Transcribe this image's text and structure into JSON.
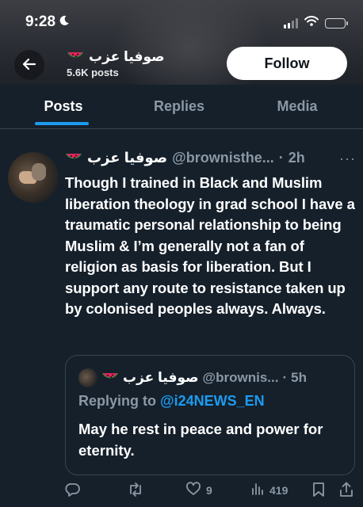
{
  "status_bar": {
    "time": "9:28"
  },
  "header": {
    "profile_name": "صوفيا عزب",
    "post_count": "5.6K posts",
    "follow_label": "Follow"
  },
  "tabs": [
    {
      "label": "Posts",
      "active": true
    },
    {
      "label": "Replies",
      "active": false
    },
    {
      "label": "Media",
      "active": false
    }
  ],
  "tweet": {
    "name": "صوفيا عزب",
    "handle": "@brownisthe...",
    "separator": "·",
    "time": "2h",
    "more": "···",
    "body": "Though I trained in Black and Muslim liberation theology in grad school I have a traumatic personal relationship to being Muslim & I’m generally not a fan of religion as basis for liberation. But I support any route to resistance taken up by colonised peoples always. Always.",
    "quote": {
      "name": "صوفيا عزب",
      "handle": "@brownis...",
      "separator": "·",
      "time": "5h",
      "replying_prefix": "Replying to",
      "replying_to": "@i24NEWS_EN",
      "body": "May he rest in peace and power for eternity."
    },
    "actions": {
      "likes": "9",
      "views": "419"
    }
  },
  "colors": {
    "background": "#15202b",
    "accent": "#1d9bf0",
    "muted": "#8b98a5",
    "border": "#38444d"
  },
  "icons": [
    "back-arrow-icon",
    "watermelon-icon",
    "reply-icon",
    "retweet-icon",
    "heart-icon",
    "views-icon",
    "bookmark-icon",
    "share-icon",
    "moon-icon",
    "signal-icon",
    "wifi-icon",
    "battery-icon"
  ]
}
